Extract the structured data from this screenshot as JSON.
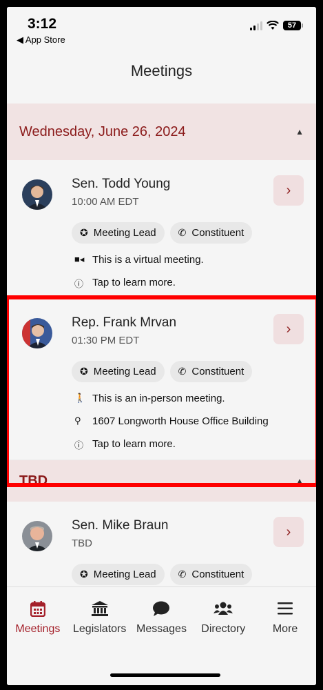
{
  "status_bar": {
    "time": "3:12",
    "back_label": "◀ App Store",
    "battery": "57"
  },
  "nav": {
    "title": "Meetings"
  },
  "sections": [
    {
      "header": "Wednesday, June 26, 2024",
      "meetings": [
        {
          "name": "Sen. Todd Young",
          "time": "10:00 AM EDT",
          "chips": [
            "Meeting Lead",
            "Constituent"
          ],
          "rows": [
            {
              "icon": "video-icon",
              "text": "This is a virtual meeting."
            },
            {
              "icon": "info-icon",
              "text": "Tap to learn more."
            }
          ]
        },
        {
          "name": "Rep. Frank Mrvan",
          "time": "01:30 PM EDT",
          "chips": [
            "Meeting Lead",
            "Constituent"
          ],
          "rows": [
            {
              "icon": "person-icon",
              "text": "This is an in-person meeting."
            },
            {
              "icon": "location-pin-icon",
              "text": "1607 Longworth House Office Building"
            },
            {
              "icon": "info-icon",
              "text": "Tap to learn more."
            }
          ]
        }
      ]
    },
    {
      "header": "TBD",
      "meetings": [
        {
          "name": "Sen. Mike Braun",
          "time": "TBD",
          "chips": [
            "Meeting Lead",
            "Constituent"
          ],
          "rows": []
        }
      ]
    }
  ],
  "tabbar": {
    "tabs": [
      {
        "label": "Meetings",
        "icon": "calendar-icon",
        "active": true
      },
      {
        "label": "Legislators",
        "icon": "capitol-icon",
        "active": false
      },
      {
        "label": "Messages",
        "icon": "chat-bubble-icon",
        "active": false
      },
      {
        "label": "Directory",
        "icon": "people-icon",
        "active": false
      },
      {
        "label": "More",
        "icon": "hamburger-menu-icon",
        "active": false
      }
    ]
  },
  "colors": {
    "accent": "#8b1a1a",
    "section_bg": "#f1e3e3",
    "highlight": "#ff0000"
  }
}
